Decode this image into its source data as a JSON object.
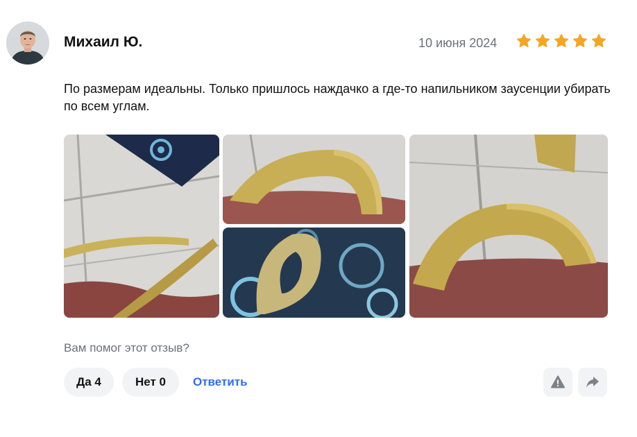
{
  "review": {
    "author": "Михаил Ю.",
    "date": "10 июня 2024",
    "rating": 5,
    "rating_max": 5,
    "star_color": "#f5a623",
    "text": "По размерам идеальны. Только пришлось наждачко а где-то напильником заусенции убирать по всем углам."
  },
  "photos": [
    {
      "icon": "photo-brass-arcs-on-tile"
    },
    {
      "icon": "photo-brass-half-ring"
    },
    {
      "icon": "photo-brass-ring-on-gears"
    },
    {
      "icon": "photo-brass-arch-on-tile"
    }
  ],
  "feedback": {
    "question": "Вам помог этот отзыв?",
    "yes_label": "Да",
    "yes_count": "4",
    "no_label": "Нет",
    "no_count": "0",
    "reply_label": "Ответить",
    "reply_color": "#2f6df6"
  },
  "actions": {
    "report_icon": "warning-icon",
    "share_icon": "share-arrow-icon"
  }
}
